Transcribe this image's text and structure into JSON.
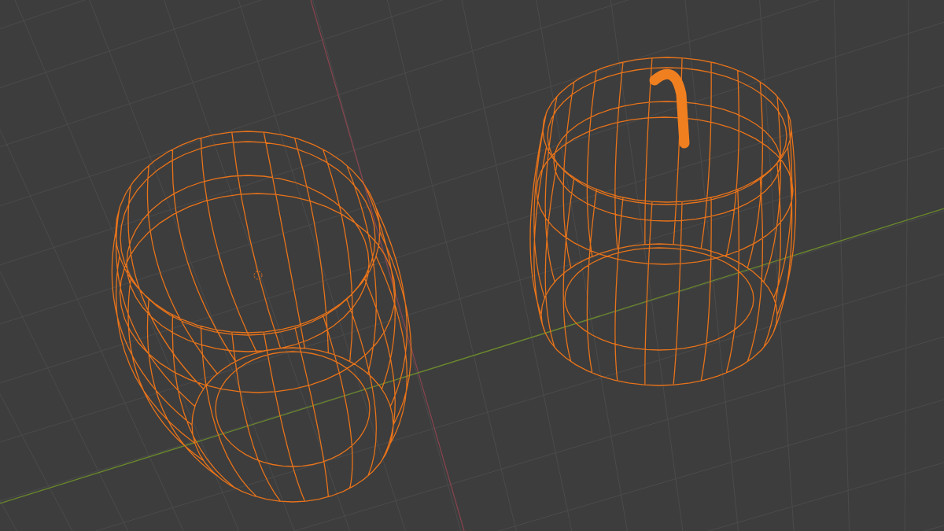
{
  "viewport": {
    "objects": [
      {
        "kind": "barrel"
      },
      {
        "kind": "barrel-with-handle"
      }
    ]
  }
}
